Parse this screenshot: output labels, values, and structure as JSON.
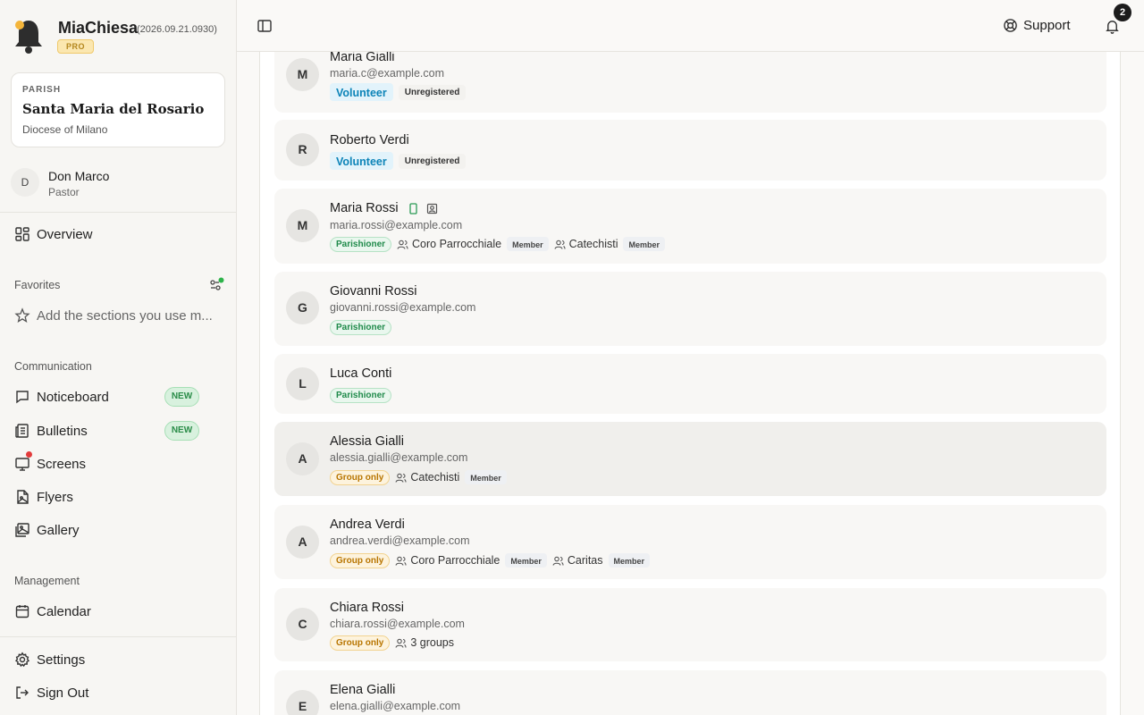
{
  "app": {
    "name": "MiaChiesa",
    "version": "(2026.09.21.0930)",
    "plan_badge": "PRO"
  },
  "parish": {
    "label": "PARISH",
    "name": "Santa Maria del Rosario",
    "diocese": "Diocese of Milano"
  },
  "user": {
    "initial": "D",
    "name": "Don Marco",
    "role": "Pastor"
  },
  "nav": {
    "overview": "Overview",
    "favorites_title": "Favorites",
    "favorites_placeholder": "Add the sections you use m...",
    "communication_title": "Communication",
    "noticeboard": "Noticeboard",
    "bulletins": "Bulletins",
    "screens": "Screens",
    "flyers": "Flyers",
    "gallery": "Gallery",
    "new_badge": "NEW",
    "management_title": "Management",
    "calendar": "Calendar",
    "settings": "Settings",
    "sign_out": "Sign Out"
  },
  "topbar": {
    "support": "Support",
    "notifications_count": "2"
  },
  "people": [
    {
      "initial": "M",
      "name": "Maria Gialli",
      "email": "maria.c@example.com",
      "role": "Volunteer",
      "status": "Unregistered"
    },
    {
      "initial": "R",
      "name": "Roberto Verdi",
      "role": "Volunteer",
      "status": "Unregistered"
    },
    {
      "initial": "M",
      "name": "Maria Rossi",
      "email": "maria.rossi@example.com",
      "role": "Parishioner",
      "groups": [
        {
          "name": "Coro Parrocchiale",
          "badge": "Member"
        },
        {
          "name": "Catechisti",
          "badge": "Member"
        }
      ]
    },
    {
      "initial": "G",
      "name": "Giovanni Rossi",
      "email": "giovanni.rossi@example.com",
      "role": "Parishioner"
    },
    {
      "initial": "L",
      "name": "Luca Conti",
      "role": "Parishioner"
    },
    {
      "initial": "A",
      "name": "Alessia Gialli",
      "email": "alessia.gialli@example.com",
      "role": "Group only",
      "groups": [
        {
          "name": "Catechisti",
          "badge": "Member"
        }
      ]
    },
    {
      "initial": "A",
      "name": "Andrea Verdi",
      "email": "andrea.verdi@example.com",
      "role": "Group only",
      "groups": [
        {
          "name": "Coro Parrocchiale",
          "badge": "Member"
        },
        {
          "name": "Caritas",
          "badge": "Member"
        }
      ]
    },
    {
      "initial": "C",
      "name": "Chiara Rossi",
      "email": "chiara.rossi@example.com",
      "role": "Group only",
      "groups_summary": "3 groups"
    },
    {
      "initial": "E",
      "name": "Elena Gialli",
      "email": "elena.gialli@example.com"
    }
  ]
}
